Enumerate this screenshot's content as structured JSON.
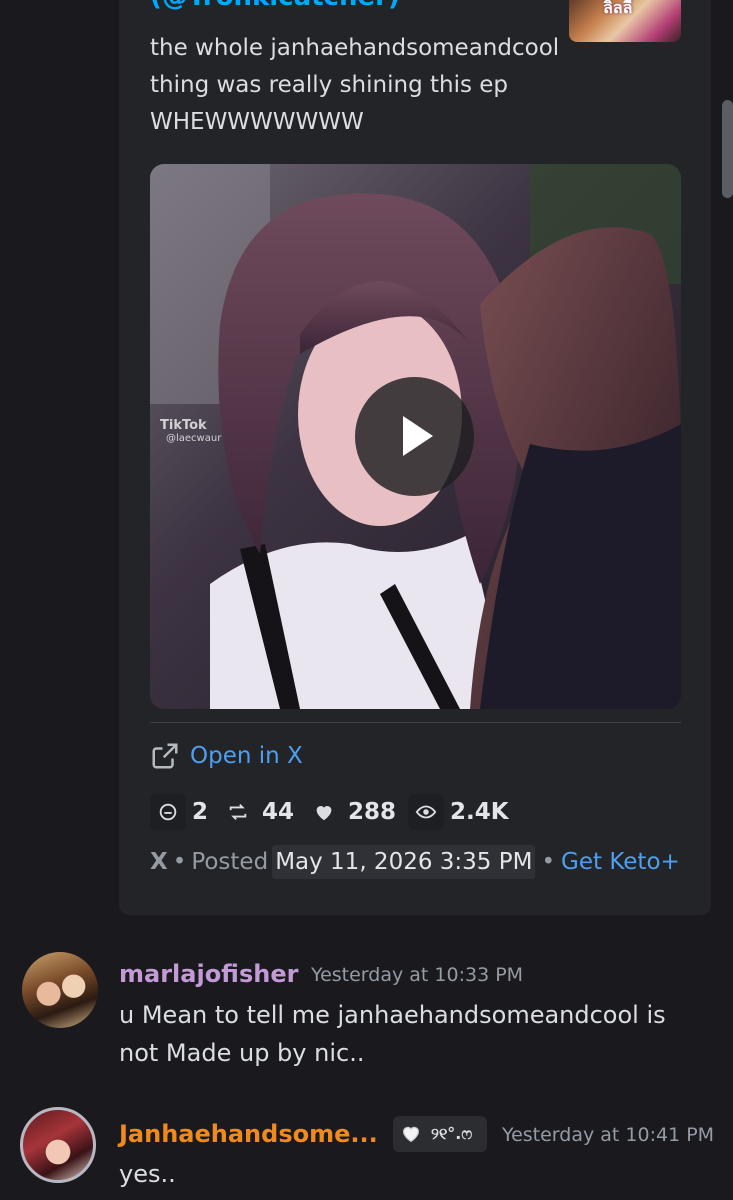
{
  "embed": {
    "author": "(@Tronkicatcher)",
    "thumbnail_text": "ลิลลี่",
    "description_lines": [
      "the whole janhaehandsomeandcool",
      "thing was really shining this ep",
      "WHEWWWWWWW"
    ],
    "video": {
      "watermark": "TikTok",
      "watermark_user": "@laecwaur",
      "play_icon": "play-icon"
    },
    "open_link": "Open in X",
    "stats": {
      "replies": "2",
      "reposts": "44",
      "likes": "288",
      "views": "2.4K"
    },
    "footer": {
      "source": "X",
      "separator": "•",
      "posted_label": "Posted",
      "date": "May 11, 2026 3:35 PM",
      "link": "Get Keto+"
    }
  },
  "messages": [
    {
      "author": "marlajofisher",
      "timestamp": "Yesterday at 10:33 PM",
      "lines": [
        "u Mean to tell me janhaehandsomeandcool is",
        "not Made up by nic.."
      ],
      "name_color": "#c39ad6"
    },
    {
      "author": "Janhaehandsome...",
      "tag_text": "୨୧°.ෆ",
      "timestamp": "Yesterday at 10:41 PM",
      "text": "yes..",
      "name_color": "#f08a1c"
    }
  ],
  "colors": {
    "background": "#1a1a1e",
    "embed_bg": "#232428",
    "link": "#4f9ef0"
  }
}
